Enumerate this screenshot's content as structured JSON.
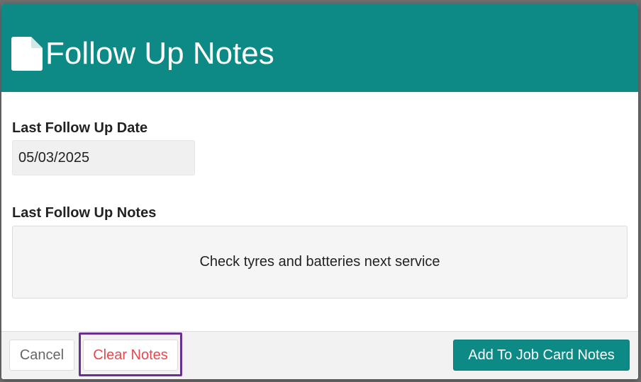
{
  "modal": {
    "title": "Follow Up Notes",
    "header_icon": "document-icon",
    "colors": {
      "header": "#0e8a86",
      "primary_button": "#0e8a86",
      "danger_text": "#e8474d",
      "highlight_outline": "#6b2f8f"
    }
  },
  "fields": {
    "last_date_label": "Last Follow Up Date",
    "last_date_value": "05/03/2025",
    "last_notes_label": "Last Follow Up Notes",
    "last_notes_value": "Check tyres and batteries next service"
  },
  "footer": {
    "cancel_label": "Cancel",
    "clear_label": "Clear Notes",
    "add_label": "Add To Job Card Notes"
  }
}
